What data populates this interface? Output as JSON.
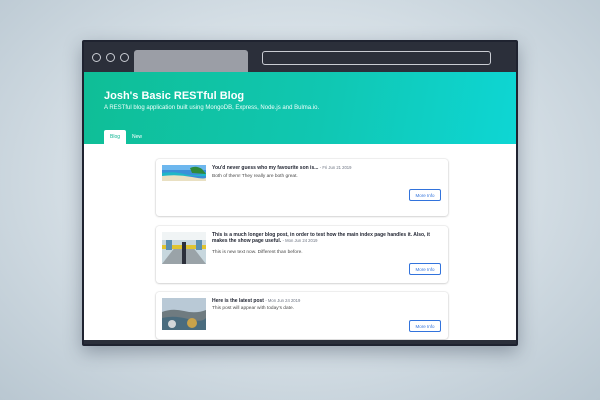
{
  "hero": {
    "title": "Josh's Basic RESTful Blog",
    "subtitle": "A RESTful blog application built using MongoDB, Express, Node.js and Bulma.io."
  },
  "nav": {
    "tabs": [
      {
        "label": "Blog",
        "active": true
      },
      {
        "label": "New",
        "active": false
      }
    ]
  },
  "posts": [
    {
      "title": "You'd never guess who my favourite son is...",
      "date": "- Fri Jun 21 2019",
      "body": "Both of them! They really are both great.",
      "button": "More Info",
      "thumb": "beach"
    },
    {
      "title": "This is a much longer blog post, in order to test how the main index page handles it. Also, it makes the show page useful.",
      "date": "- Mon Jun 24 2019",
      "body": "This is new text now. Different than before.",
      "button": "More Info",
      "thumb": "subway"
    },
    {
      "title": "Here is the latest post",
      "date": "- Mon Jun 24 2019",
      "body": "This post will appear with today's date.",
      "button": "More Info",
      "thumb": "coast"
    }
  ],
  "colors": {
    "accent": "#12b594",
    "link": "#3273dc"
  }
}
